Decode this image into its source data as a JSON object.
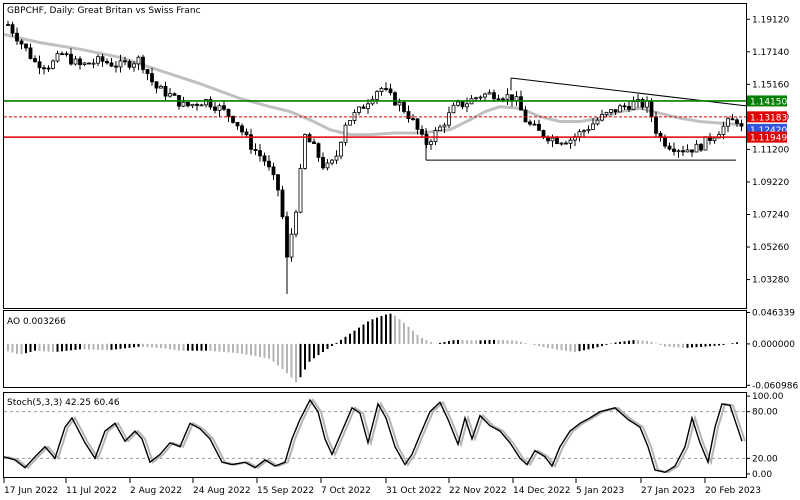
{
  "chart_data": [
    {
      "panel": "price",
      "type": "candlestick",
      "title": "GBPCHF, Daily:  Great Britan vs Swiss Franc",
      "y_ticks": [
        "1.19120",
        "1.17140",
        "1.15160",
        "1.13180",
        "1.11200",
        "1.09220",
        "1.07240",
        "1.05260",
        "1.03280"
      ],
      "ylim": [
        1.0155,
        1.2005
      ],
      "grid": false,
      "x_ticks": [
        "17 Jun 2022",
        "11 Jul 2022",
        "2 Aug 2022",
        "24 Aug 2022",
        "15 Sep 2022",
        "7 Oct 2022",
        "31 Oct 2022",
        "22 Nov 2022",
        "14 Dec 2022",
        "5 Jan 2023",
        "27 Jan 2023",
        "20 Feb 2023"
      ],
      "levels": [
        {
          "label": "1.14150",
          "value": 1.1415,
          "color": "#008000"
        },
        {
          "label": "1.13183",
          "value": 1.13183,
          "color": "#e00000"
        },
        {
          "label": "1.12420",
          "value": 1.1242,
          "color": "#3355dd"
        },
        {
          "label": "1.11949",
          "value": 1.11949,
          "color": "#e00000"
        }
      ],
      "overlays": [
        "moving average (gray)",
        "trendline",
        "support rectangle"
      ]
    },
    {
      "panel": "ao",
      "type": "bar",
      "title": "AO 0.003266",
      "y_ticks": [
        "0.046339",
        "0.000000",
        "-0.060986"
      ],
      "ylim": [
        -0.0635,
        0.0485
      ]
    },
    {
      "panel": "stochastic",
      "type": "line",
      "title": "Stoch(5,3,3) 42.25 60.46",
      "y_ticks": [
        "100.00",
        "80.00",
        "20.00",
        "0.00"
      ],
      "ylim": [
        -4,
        104
      ]
    }
  ],
  "colors": {
    "ma": "#c0c0c0",
    "up": "#000000",
    "down": "#000000",
    "stoch_main": "#000000",
    "stoch_signal": "#b4b4b4",
    "support_line": "#008000",
    "resist_line": "#e00000"
  }
}
